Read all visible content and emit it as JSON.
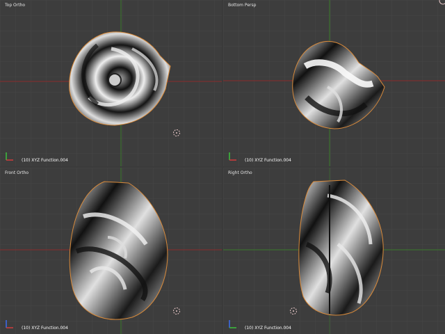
{
  "viewports": {
    "top_left": {
      "view_label": "Top Ortho",
      "object_label": "(10) XYZ Function.004"
    },
    "top_right": {
      "view_label": "Bottom Persp",
      "object_label": "(10) XYZ Function.004"
    },
    "bottom_left": {
      "view_label": "Front Ortho",
      "object_label": "(10) XYZ Function.004"
    },
    "bottom_right": {
      "view_label": "Right Ortho",
      "object_label": "(10) XYZ Function.004"
    }
  },
  "colors": {
    "background": "#3d3d3d",
    "grid_line": "#474747",
    "x_axis": "#8a2b2b",
    "y_axis": "#3b7a2b",
    "selection_outline": "#d98a3a",
    "cursor": "#e8c8c8"
  }
}
